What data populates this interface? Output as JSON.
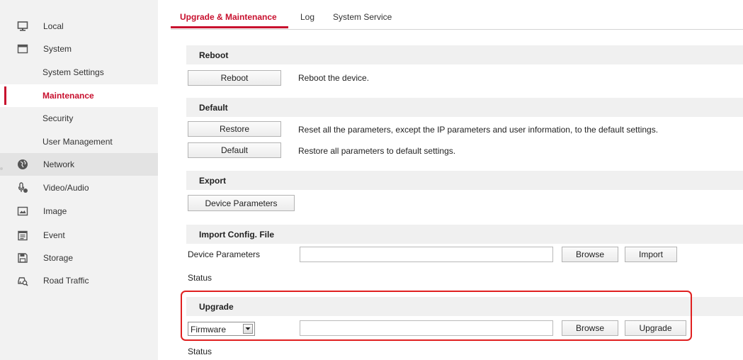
{
  "sidebar": {
    "items": [
      {
        "label": "Local",
        "icon": "monitor-icon"
      },
      {
        "label": "System",
        "icon": "window-icon"
      },
      {
        "label": "System Settings"
      },
      {
        "label": "Maintenance"
      },
      {
        "label": "Security"
      },
      {
        "label": "User Management"
      },
      {
        "label": "Network",
        "icon": "globe-icon"
      },
      {
        "label": "Video/Audio",
        "icon": "microphone-icon"
      },
      {
        "label": "Image",
        "icon": "image-icon"
      },
      {
        "label": "Event",
        "icon": "calendar-icon"
      },
      {
        "label": "Storage",
        "icon": "save-icon"
      },
      {
        "label": "Road Traffic",
        "icon": "car-search-icon"
      }
    ]
  },
  "tabs": [
    "Upgrade & Maintenance",
    "Log",
    "System Service"
  ],
  "reboot": {
    "title": "Reboot",
    "button": "Reboot",
    "desc": "Reboot the device."
  },
  "default_section": {
    "title": "Default",
    "restore_button": "Restore",
    "restore_desc": "Reset all the parameters, except the IP parameters and user information, to the default settings.",
    "default_button": "Default",
    "default_desc": "Restore all parameters to default settings."
  },
  "export": {
    "title": "Export",
    "button": "Device Parameters"
  },
  "import": {
    "title": "Import Config. File",
    "field_label": "Device Parameters",
    "file_value": "",
    "browse": "Browse",
    "import_button": "Import",
    "status_label": "Status"
  },
  "upgrade": {
    "title": "Upgrade",
    "type_selected": "Firmware",
    "file_value": "",
    "browse": "Browse",
    "upgrade_button": "Upgrade",
    "status_label": "Status"
  },
  "colors": {
    "accent": "#c8102e",
    "highlight_box": "#e02020"
  }
}
